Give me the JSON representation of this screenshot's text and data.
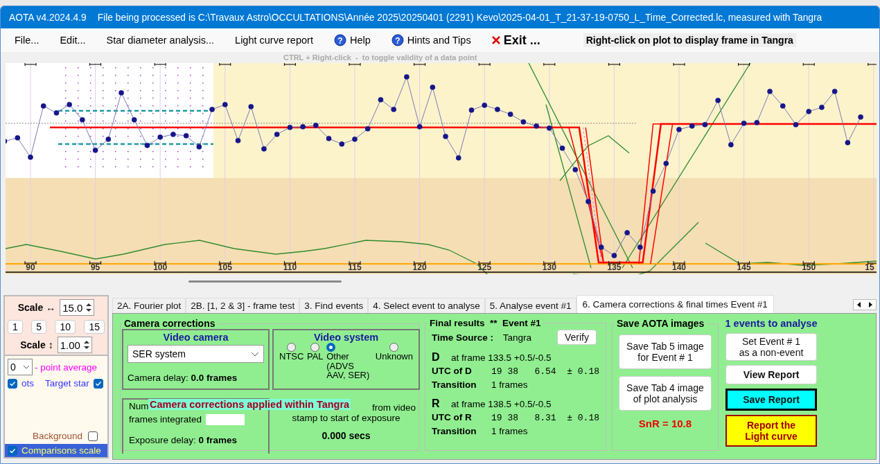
{
  "window": {
    "title": "AOTA v4.2024.4.9",
    "file_info": "File being processed is C:\\Travaux Astro\\OCCULTATIONS\\Année 2025\\20250401 (2291) Kevo\\2025-04-01_T_21-37-19-0750_L_Time_Corrected.lc, measured with Tangra"
  },
  "menu": [
    {
      "label": "File...",
      "kind": "plain"
    },
    {
      "label": "Edit...",
      "kind": "plain"
    },
    {
      "label": "Star diameter analysis...",
      "kind": "plain"
    },
    {
      "label": "Light curve report",
      "kind": "plain"
    },
    {
      "label": "Help",
      "kind": "help",
      "icon": "?"
    },
    {
      "label": "Hints and Tips",
      "kind": "help",
      "icon": "?"
    },
    {
      "label": "Exit ...",
      "kind": "exit"
    }
  ],
  "plot_hint": "Right-click on plot to display frame in Tangra",
  "toggle_hint": "CTRL + Right-click  -  to toggle validity of a data point",
  "plot": {
    "x_tick_labels": [
      "90",
      "95",
      "100",
      "105",
      "110",
      "115",
      "120",
      "125",
      "130",
      "135",
      "140",
      "145",
      "150",
      "15"
    ]
  },
  "scale": {
    "horizontal": {
      "label": "Scale ↔",
      "value": "15.0"
    },
    "presets": [
      "1",
      "5",
      "10",
      "15"
    ],
    "vertical": {
      "label": "Scale ↕",
      "value": "1.00"
    }
  },
  "display_options": {
    "average": {
      "value": "0",
      "label": "- point average"
    },
    "checks": [
      {
        "label": "ots",
        "checked": true,
        "kind": "plot"
      },
      {
        "label": "Target star",
        "checked": true,
        "kind": "target"
      },
      {
        "label": "Background",
        "checked": false,
        "kind": "background"
      },
      {
        "label": "Comparisons scale",
        "checked": true,
        "kind": "comparisons"
      }
    ]
  },
  "tabs": [
    {
      "label": "2A. Fourier plot",
      "selected": false
    },
    {
      "label": "2B. [1, 2 & 3] - frame test",
      "selected": false
    },
    {
      "label": "3. Find events",
      "selected": false
    },
    {
      "label": "4. Select event to analyse",
      "selected": false
    },
    {
      "label": "5. Analyse event #1",
      "selected": false
    },
    {
      "label": "6. Camera corrections & final times Event #1",
      "selected": true
    }
  ],
  "camera_corrections": {
    "title": "Camera corrections",
    "video_camera": {
      "title": "Video camera",
      "selection": "SER system",
      "delay": "Camera delay: **0.0 frames**"
    },
    "video_system": {
      "title": "Video system",
      "options": [
        {
          "label": "NTSC",
          "selected": false
        },
        {
          "label": "PAL",
          "selected": false
        },
        {
          "label": "Other\n(ADVS\nAAV, SER)",
          "selected": true
        },
        {
          "label": "Unknown",
          "selected": false
        }
      ]
    },
    "integration": {
      "label_start": "Num",
      "label_end": "frames integrated",
      "exposure_delay": "Exposure delay: **0 frames**"
    },
    "offset": {
      "label_end": "from video",
      "label_line2": "stamp to start of exposure",
      "value": "0.000 secs"
    },
    "overlay": "Camera corrections applied within Tangra"
  },
  "final_results": {
    "title": "Final results  **  Event #1",
    "verify": "Verify",
    "time_source": {
      "label": "Time Source :",
      "value": "Tangra"
    },
    "events": [
      {
        "letter": "D",
        "frame": "at frame 133.5  +0.5/-0.5",
        "utc_label": "UTC of D",
        "utc": "19 38   6.54  ± 0.18",
        "transition_label": "Transition",
        "transition": "1 frames"
      },
      {
        "letter": "R",
        "frame": "at frame 138.5  +0.5/-0.5",
        "utc_label": "UTC of R",
        "utc": "19 38   8.31  ± 0.18",
        "transition_label": "Transition",
        "transition": "1 frames"
      }
    ]
  },
  "save_images": {
    "title": "Save AOTA images",
    "buttons": [
      "Save Tab 5 image\nfor Event # 1",
      "Save Tab 4 image\nof plot analysis"
    ],
    "snr": "SnR = 10.8"
  },
  "actions": {
    "events_count": "1 events to analyse",
    "buttons": [
      {
        "label": "Set Event # 1\nas a non-event",
        "kind": "plain"
      },
      {
        "label": "View Report",
        "kind": "bold"
      },
      {
        "label": "Save Report",
        "kind": "primary"
      },
      {
        "label": "Report the\nLight curve",
        "kind": "report"
      }
    ]
  }
}
